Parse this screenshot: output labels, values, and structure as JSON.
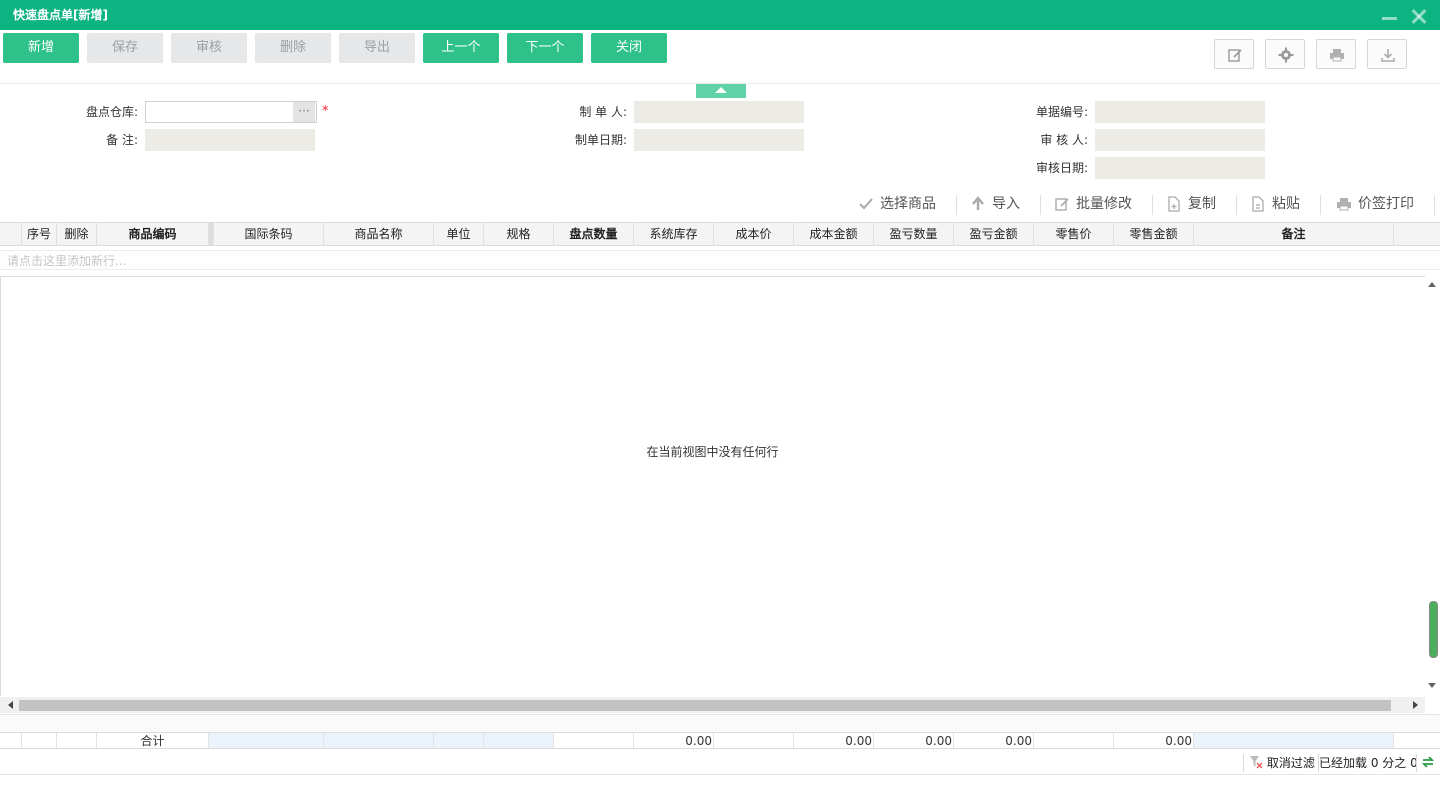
{
  "window": {
    "title": "快速盘点单[新增]"
  },
  "toolbar": {
    "new": "新增",
    "save": "保存",
    "audit": "审核",
    "delete": "删除",
    "export": "导出",
    "prev": "上一个",
    "next": "下一个",
    "close": "关闭"
  },
  "right_icons": [
    "edit-icon",
    "gear-icon",
    "print-icon",
    "download-icon"
  ],
  "form": {
    "warehouse_label": "盘点仓库:",
    "warehouse_value": "",
    "remark_label": "备 注:",
    "remark_value": "",
    "creator_label": "制 单 人:",
    "creator_value": "",
    "create_date_label": "制单日期:",
    "create_date_value": "",
    "bill_no_label": "单据编号:",
    "bill_no_value": "",
    "auditor_label": "审 核 人:",
    "auditor_value": "",
    "audit_date_label": "审核日期:",
    "audit_date_value": "",
    "required_mark": "*"
  },
  "grid_tools": {
    "select_goods": "选择商品",
    "import": "导入",
    "batch_edit": "批量修改",
    "copy": "复制",
    "paste": "粘贴",
    "price_tag_print": "价签打印"
  },
  "columns": {
    "seq": "序号",
    "del": "删除",
    "code": "商品编码",
    "barcode": "国际条码",
    "name": "商品名称",
    "unit": "单位",
    "spec": "规格",
    "count_qty": "盘点数量",
    "sys_stock": "系统库存",
    "cost_price": "成本价",
    "cost_amount": "成本金额",
    "pl_qty": "盈亏数量",
    "pl_amount": "盈亏金额",
    "retail_price": "零售价",
    "retail_amount": "零售金额",
    "remark": "备注"
  },
  "grid": {
    "add_row_hint": "请点击这里添加新行...",
    "empty_message": "在当前视图中没有任何行"
  },
  "summary": {
    "label": "合计",
    "count_qty": "0.00",
    "cost_amount": "0.00",
    "pl_qty": "0.00",
    "pl_amount": "0.00",
    "retail_amount": "0.00"
  },
  "status": {
    "cancel_filter": "取消过滤",
    "loaded": "已经加载 0 分之 0"
  },
  "colors": {
    "primary": "#0db380",
    "button": "#2ec28a",
    "disabled": "#e5e7e8"
  }
}
